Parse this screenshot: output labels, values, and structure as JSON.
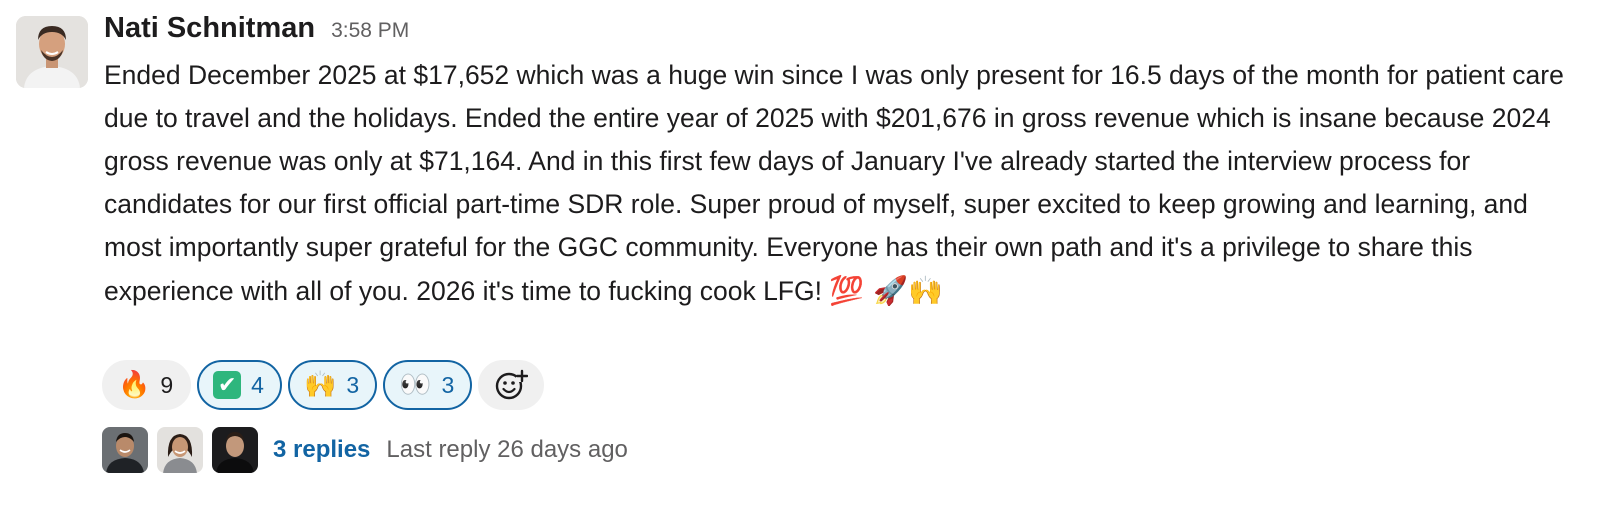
{
  "message": {
    "author": "Nati Schnitman",
    "timestamp": "3:58 PM",
    "text": "Ended December 2025 at $17,652 which was a huge win since I was only present for 16.5 days of the month for patient care due to travel and the holidays. Ended the entire year of 2025 with $201,676 in gross revenue which is insane because 2024 gross revenue was only at $71,164. And in this first few days of January I've already started the interview process for candidates for our first official part-time SDR role. Super proud of myself, super excited to keep growing and learning, and most importantly super grateful for the GGC community. Everyone has their own path and it's a privilege to share this experience with all of you. 2026 it's time to fucking cook LFG!",
    "trailing_emojis": "💯 🚀🙌"
  },
  "reactions": [
    {
      "emoji": "🔥",
      "icon": "fire-icon",
      "count": "9",
      "active": false
    },
    {
      "emoji": "✔",
      "icon": "white-check-mark-icon",
      "count": "4",
      "active": true
    },
    {
      "emoji": "🙌",
      "icon": "raised-hands-icon",
      "count": "3",
      "active": true
    },
    {
      "emoji": "👀",
      "icon": "eyes-icon",
      "count": "3",
      "active": true
    }
  ],
  "add_reaction_icon": "add-reaction-icon",
  "thread": {
    "replies_label": "3 replies",
    "last_reply": "Last reply 26 days ago"
  },
  "colors": {
    "link_blue": "#1264a3",
    "active_reaction_bg": "#e8f5fa",
    "reaction_bg": "#f0f0f0",
    "muted_text": "#616061"
  }
}
